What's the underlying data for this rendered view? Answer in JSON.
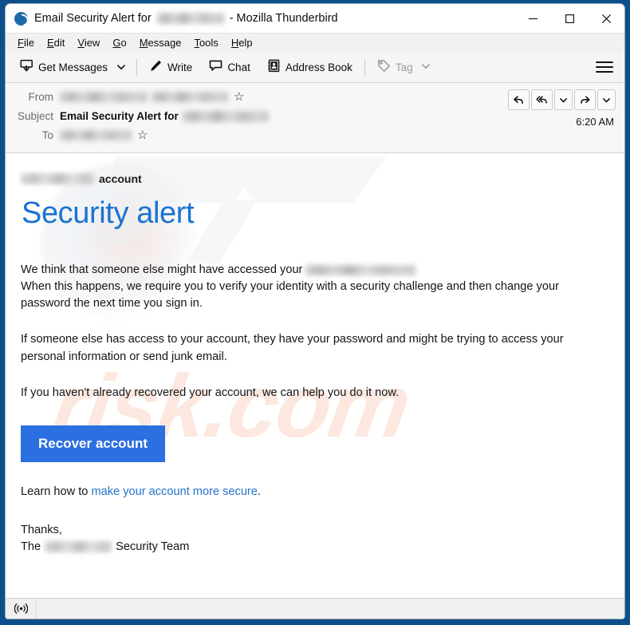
{
  "window": {
    "title_prefix": "Email Security Alert for",
    "title_redacted": true,
    "title_suffix": "- Mozilla Thunderbird",
    "app_icon": "thunderbird-icon",
    "controls": {
      "minimize": "minimize-icon",
      "maximize": "maximize-icon",
      "close": "close-icon"
    }
  },
  "menubar": {
    "items": [
      {
        "accesskey": "F",
        "rest": "ile"
      },
      {
        "accesskey": "E",
        "rest": "dit"
      },
      {
        "accesskey": "V",
        "rest": "iew"
      },
      {
        "accesskey": "G",
        "rest": "o"
      },
      {
        "accesskey": "M",
        "rest": "essage"
      },
      {
        "accesskey": "T",
        "rest": "ools"
      },
      {
        "accesskey": "H",
        "rest": "elp"
      }
    ]
  },
  "toolbar": {
    "get_messages": "Get Messages",
    "write": "Write",
    "chat": "Chat",
    "address_book": "Address Book",
    "tag": "Tag",
    "tag_disabled": true,
    "app_menu": "app-menu-icon"
  },
  "message_header": {
    "from_label": "From",
    "from_value_redacted": true,
    "subject_label": "Subject",
    "subject_value": "Email Security Alert for",
    "subject_value_redacted": true,
    "to_label": "To",
    "to_value_redacted": true,
    "time": "6:20 AM",
    "actions": [
      {
        "name": "reply-button",
        "icon": "reply-icon"
      },
      {
        "name": "reply-all-button",
        "icon": "reply-all-icon"
      },
      {
        "name": "reply-more-button",
        "icon": "chevron-down-icon"
      },
      {
        "name": "forward-button",
        "icon": "forward-icon"
      },
      {
        "name": "more-actions-button",
        "icon": "chevron-down-icon"
      }
    ]
  },
  "body": {
    "account_suffix": "account",
    "account_brand_redacted": true,
    "heading": "Security alert",
    "paragraph1_line1": "We think that someone else might have accessed your",
    "paragraph1_line1_redacted": true,
    "paragraph1_line2": "When this happens, we require you to verify your identity with a security challenge and then change your password the next time you sign in.",
    "paragraph2": "If someone else has access to your account, they have your password and might be trying to access your personal information or send junk email.",
    "paragraph3": "If you haven't already recovered your account, we can help you do it now.",
    "cta_label": "Recover account",
    "learn_prefix": "Learn how to",
    "learn_link": "make your account more secure",
    "learn_suffix": ".",
    "sign_off": "Thanks,",
    "sign_prefix": "The",
    "sign_brand_redacted": true,
    "sign_suffix": "Security Team",
    "watermark_text": "risk.com"
  },
  "statusbar": {
    "connection_icon": "broadcast-icon"
  },
  "colors": {
    "window_border": "#0d4f8b",
    "heading_blue": "#1a73d0",
    "cta_blue": "#2b6fe0",
    "link_blue": "#2672cc",
    "watermark": "#fad6c4"
  }
}
